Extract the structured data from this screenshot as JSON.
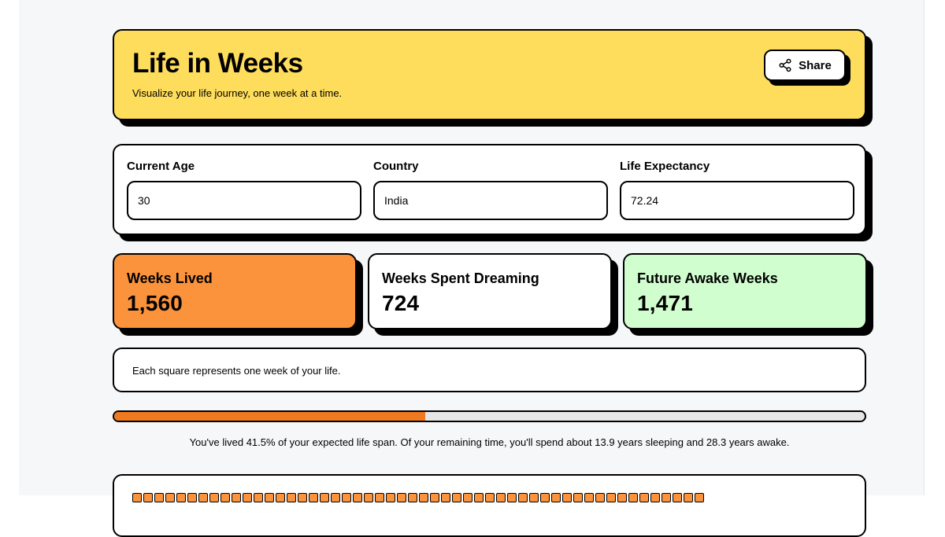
{
  "header": {
    "title": "Life in Weeks",
    "subtitle": "Visualize your life journey, one week at a time.",
    "share_label": "Share",
    "share_icon": "share-icon"
  },
  "inputs": {
    "age": {
      "label": "Current Age",
      "value": "30"
    },
    "country": {
      "label": "Country",
      "value": "India"
    },
    "expectancy": {
      "label": "Life Expectancy",
      "value": "72.24"
    }
  },
  "stats": {
    "lived": {
      "label": "Weeks Lived",
      "value": "1,560"
    },
    "dreaming": {
      "label": "Weeks Spent Dreaming",
      "value": "724"
    },
    "awake": {
      "label": "Future Awake Weeks",
      "value": "1,471"
    }
  },
  "info": {
    "text": "Each square represents one week of your life."
  },
  "progress": {
    "percent": 41.5,
    "caption": "You've lived 41.5% of your expected life span. Of your remaining time, you'll spend about 13.9 years sleeping and 28.3 years awake."
  },
  "colors": {
    "header_bg": "#ffdd5c",
    "lived": "#fb923c",
    "awake": "#d1fecf",
    "progress_fill": "#f07a1f"
  }
}
